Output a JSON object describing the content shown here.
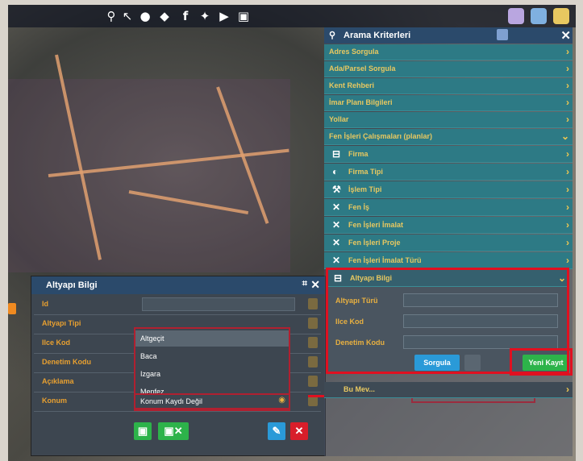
{
  "topbar": {
    "icons": [
      "search-icon",
      "cursor-icon",
      "apple-icon",
      "android-icon",
      "facebook-icon",
      "twitter-icon",
      "youtube-icon",
      "instagram-icon"
    ]
  },
  "search_panel": {
    "title": "Arama Kriterleri",
    "rows": [
      {
        "label": "Adres Sorgula"
      },
      {
        "label": "Ada/Parsel Sorgula"
      },
      {
        "label": "Kent Rehberi"
      },
      {
        "label": "İmar Planı Bilgileri"
      },
      {
        "label": "Yollar"
      },
      {
        "label": "Fen İşleri Çalışmaları (planlar)"
      }
    ],
    "subrows": [
      {
        "icon": "brush-icon",
        "label": "Firma"
      },
      {
        "icon": "paint-icon",
        "label": "Firma Tipi"
      },
      {
        "icon": "tools-icon",
        "label": "İşlem Tipi"
      },
      {
        "icon": "cross-icon",
        "label": "Fen İş"
      },
      {
        "icon": "cross-icon",
        "label": "Fen İşleri İmalat"
      },
      {
        "icon": "cross-icon",
        "label": "Fen İşleri Proje"
      },
      {
        "icon": "cross-icon",
        "label": "Fen İşleri İmalat Türü"
      }
    ],
    "infra": {
      "title": "Altyapı Bilgi",
      "fields": [
        {
          "label": "Altyapı Türü"
        },
        {
          "label": "Ilce Kod"
        },
        {
          "label": "Denetim Kodu"
        }
      ],
      "search_btn": "Sorgula",
      "new_btn": "Yeni Kayıt"
    },
    "last_row": "Bu Mev..."
  },
  "dialog": {
    "title": "Altyapı Bilgi",
    "rows": [
      {
        "label": "Id"
      },
      {
        "label": "Altyapı Tipi"
      },
      {
        "label": "Ilce Kod"
      },
      {
        "label": "Denetim Kodu"
      },
      {
        "label": "Açıklama"
      },
      {
        "label": "Konum"
      }
    ],
    "dropdown_options": [
      "Altgeçit",
      "Baca",
      "Izgara",
      "Menfez"
    ],
    "location_value": "Konum Kaydı Değil"
  },
  "colors": {
    "panel_row": "#2d7a85",
    "header": "#2b4a6b",
    "highlight": "#e01020",
    "label": "#e8a030"
  }
}
